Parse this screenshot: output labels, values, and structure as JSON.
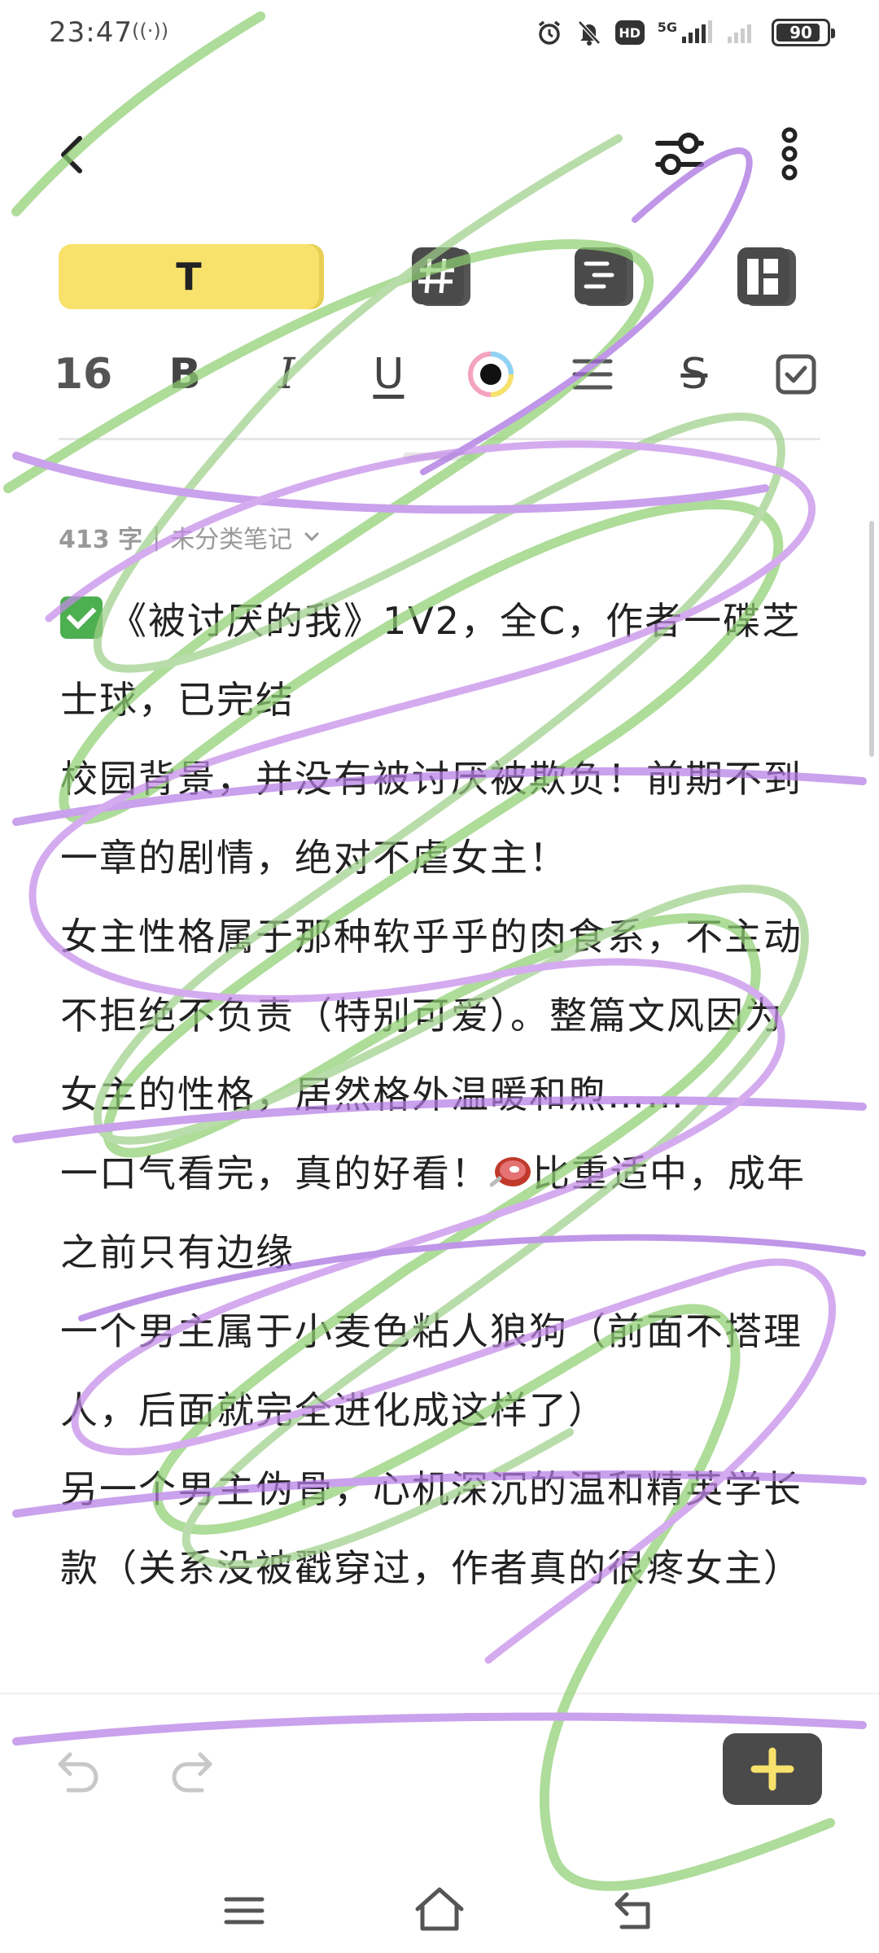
{
  "status_bar": {
    "time": "23:47",
    "vibrate_indicator": "((·))",
    "hd_label": "HD",
    "network": "5G",
    "battery": "90",
    "battery_level": 0.9
  },
  "toolbar": {
    "back_icon": "chevron-left-icon",
    "filter_icon": "sliders-icon",
    "more_icon": "more-vertical-icon"
  },
  "mode_tabs": {
    "text_tab_label": "T",
    "active_color": "#f8e26b",
    "tabs": [
      "text",
      "hashtag",
      "list",
      "grid"
    ]
  },
  "format_bar": {
    "font_size": "16",
    "bold": "B",
    "italic": "I",
    "underline": "U",
    "strike": "S"
  },
  "meta": {
    "word_count": "413 字",
    "separator": "|",
    "category": "未分类笔记"
  },
  "note": {
    "line1_title": "《被讨厌的我》1V2，全C，作者一碟芝士球，已完结",
    "line2": "校园背景，并没有被讨厌被欺负！前期不到一章的剧情，绝对不虐女主！",
    "line3": "女主性格属于那种软乎乎的肉食系，不主动不拒绝不负责（特别可爱）。整篇文风因为女主的性格，居然格外温暖和煦……",
    "line4a": "一口气看完，真的好看！",
    "line4b": "比重适中，成年之前只有边缘",
    "line5": "一个男主属于小麦色粘人狼狗（前面不搭理人，后面就完全进化成这样了）",
    "line6": "另一个男主伪骨，心机深沉的温和精英学长款（关系没被戳穿过，作者真的很疼女主）"
  },
  "bottom": {
    "undo_icon": "undo-icon",
    "redo_icon": "redo-icon",
    "add_icon": "plus-icon",
    "add_color": "#f8e26b"
  },
  "nav": {
    "menu_icon": "menu-icon",
    "home_icon": "home-icon",
    "back_icon": "back-icon"
  }
}
